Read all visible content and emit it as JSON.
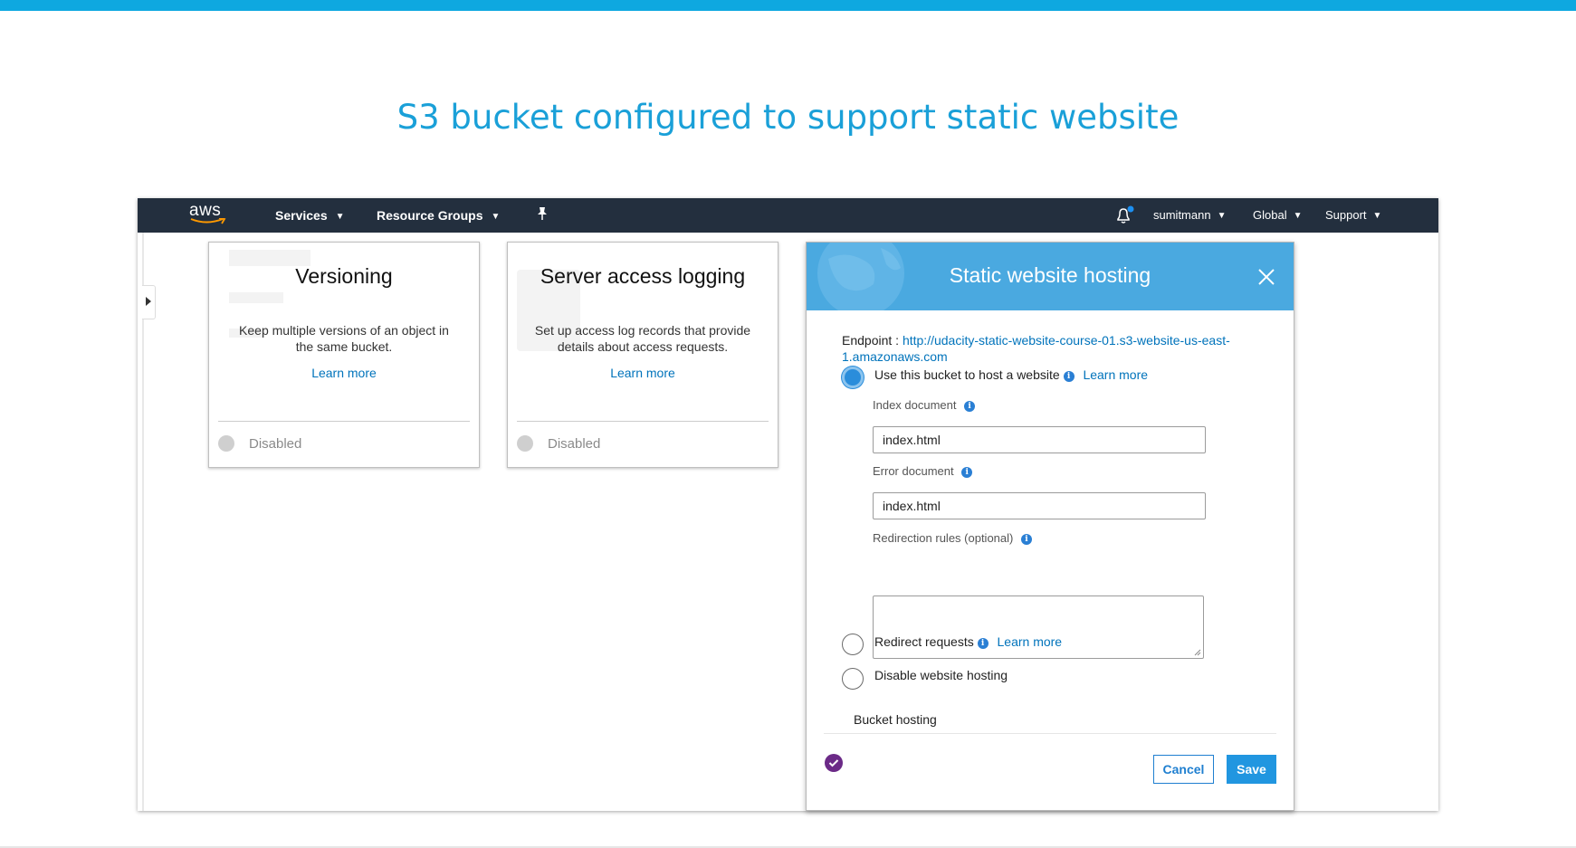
{
  "slide": {
    "title": "S3 bucket configured to support static website",
    "accent_color": "#0ea8e0"
  },
  "navbar": {
    "logo_text": "aws",
    "services": "Services",
    "resource_groups": "Resource Groups",
    "pin_icon": "pin-icon",
    "bell_icon": "bell-icon",
    "user": "sumitmann",
    "region": "Global",
    "support": "Support",
    "background_color": "#232f3e"
  },
  "cards": [
    {
      "title": "Versioning",
      "description": "Keep multiple versions of an object in the same bucket.",
      "learn_more": "Learn more",
      "status": "Disabled"
    },
    {
      "title": "Server access logging",
      "description": "Set up access log records that provide details about access requests.",
      "learn_more": "Learn more",
      "status": "Disabled"
    }
  ],
  "modal": {
    "title": "Static website hosting",
    "endpoint_label": "Endpoint :",
    "endpoint_url": "http://udacity-static-website-course-01.s3-website-us-east-1.amazonaws.com",
    "options": {
      "host": {
        "label": "Use this bucket to host a website",
        "learn_more": "Learn more",
        "selected": true
      },
      "redirect": {
        "label": "Redirect requests",
        "learn_more": "Learn more",
        "selected": false
      },
      "disable": {
        "label": "Disable website hosting",
        "selected": false
      }
    },
    "index_document": {
      "label": "Index document",
      "value": "index.html"
    },
    "error_document": {
      "label": "Error document",
      "value": "index.html"
    },
    "redirection_rules": {
      "label": "Redirection rules (optional)",
      "value": ""
    },
    "footer_status": "Bucket hosting",
    "cancel": "Cancel",
    "save": "Save",
    "header_color": "#4aa9e0",
    "primary_color": "#2196e0"
  }
}
